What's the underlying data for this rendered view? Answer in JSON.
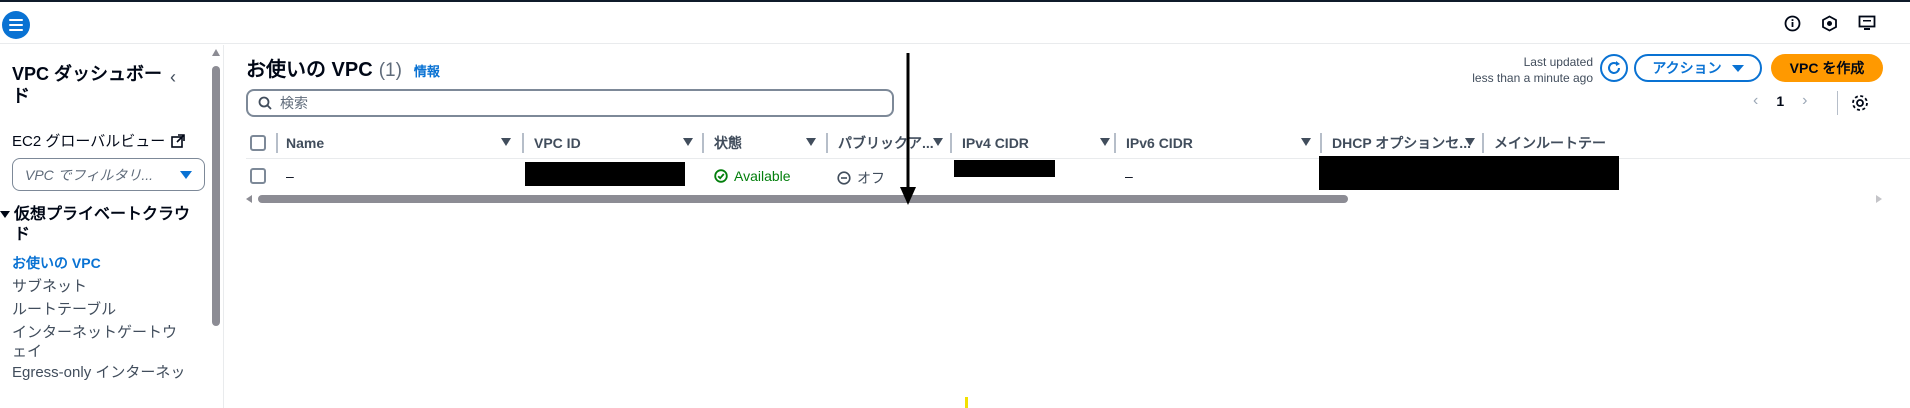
{
  "topbar": {
    "menu_icon": "hamburger-menu-icon",
    "icons": [
      "info-circle-icon",
      "notifications-icon",
      "feedback-screen-icon"
    ]
  },
  "sidebar": {
    "title": "VPC ダッシュボード",
    "collapse_icon": "chevron-left-icon",
    "ec2_link": "EC2 グローバルビュー",
    "filter_placeholder": "VPC でフィルタリ...",
    "section_title": "仮想プライベートクラウド",
    "items": [
      {
        "label": "お使いの VPC",
        "active": true
      },
      {
        "label": "サブネット",
        "active": false
      },
      {
        "label": "ルートテーブル",
        "active": false
      },
      {
        "label": "インターネットゲートウェイ",
        "active": false
      },
      {
        "label": "Egress-only インターネッ",
        "active": false
      }
    ]
  },
  "main": {
    "title": "お使いの VPC",
    "count": "(1)",
    "info_link": "情報",
    "last_updated_label": "Last updated",
    "last_updated_value": "less than a minute ago",
    "action_button": "アクション",
    "create_button": "VPC を作成",
    "search_placeholder": "検索",
    "pagination": {
      "current_page": "1"
    }
  },
  "table": {
    "columns": [
      "Name",
      "VPC ID",
      "状態",
      "パブリックア...",
      "IPv4 CIDR",
      "IPv6 CIDR",
      "DHCP オプションセ...",
      "メインルートテー"
    ],
    "rows": [
      {
        "name": "–",
        "vpc_id": "",
        "status": "Available",
        "public_access": "オフ",
        "ipv4_cidr": "",
        "ipv6_cidr": "–",
        "dhcp_options": "",
        "main_route_table": ""
      }
    ]
  },
  "colors": {
    "accent": "#0972d3",
    "primary_button": "#ff9900",
    "success": "#037f0c"
  }
}
